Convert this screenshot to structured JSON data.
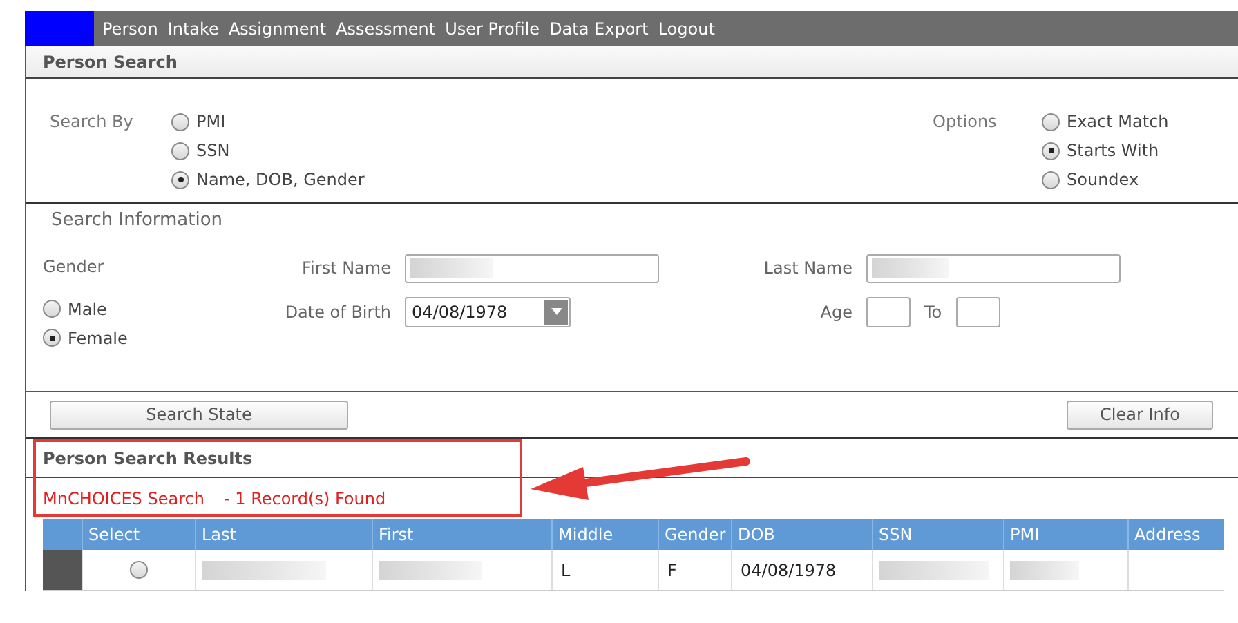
{
  "nav": {
    "items": [
      "Person",
      "Intake",
      "Assignment",
      "Assessment",
      "User Profile",
      "Data Export",
      "Logout"
    ]
  },
  "panel_title": "Person Search",
  "search_by": {
    "label": "Search By",
    "options": [
      {
        "label": "PMI",
        "selected": false
      },
      {
        "label": "SSN",
        "selected": false
      },
      {
        "label": "Name, DOB, Gender",
        "selected": true
      }
    ]
  },
  "options": {
    "label": "Options",
    "options": [
      {
        "label": "Exact Match",
        "selected": false
      },
      {
        "label": "Starts With",
        "selected": true
      },
      {
        "label": "Soundex",
        "selected": false
      }
    ]
  },
  "search_info": {
    "title": "Search Information",
    "gender_label": "Gender",
    "genders": [
      {
        "label": "Male",
        "selected": false
      },
      {
        "label": "Female",
        "selected": true
      }
    ],
    "first_name_label": "First Name",
    "last_name_label": "Last Name",
    "dob_label": "Date of Birth",
    "dob_value": "04/08/1978",
    "age_label": "Age",
    "to_label": "To"
  },
  "buttons": [
    "Search State",
    "Clear Info"
  ],
  "results": {
    "title": "Person Search Results",
    "source": "MnCHOICES Search",
    "count": "- 1 Record(s) Found",
    "columns": [
      "Select",
      "Last",
      "First",
      "Middle",
      "Gender",
      "DOB",
      "SSN",
      "PMI",
      "Address"
    ],
    "rows": [
      {
        "selected": false,
        "middle": "L",
        "gender": "F",
        "dob": "04/08/1978"
      }
    ]
  }
}
